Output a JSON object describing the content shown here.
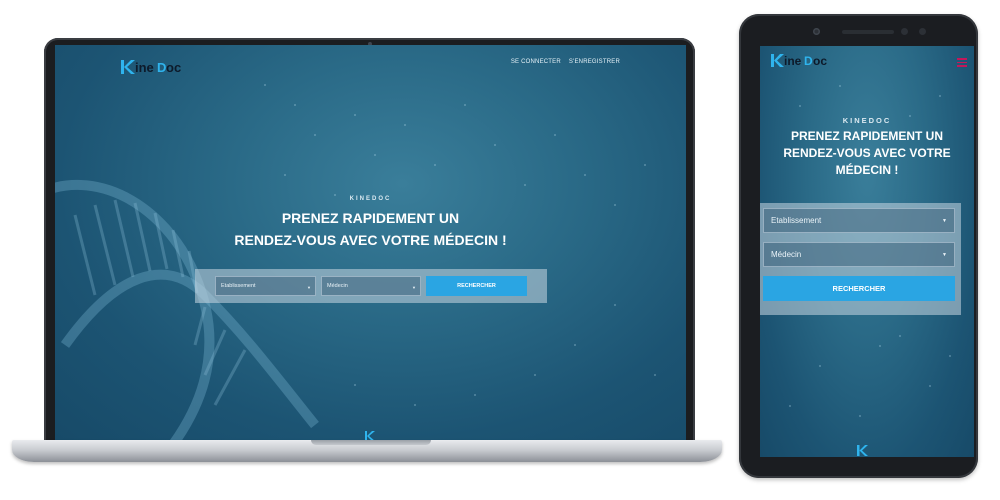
{
  "brand": {
    "logo_text": "KineDoc"
  },
  "laptop": {
    "nav": {
      "login": "SE CONNECTER",
      "register": "S'ENREGISTRER"
    },
    "hero": {
      "eyebrow": "KINEDOC",
      "title_line1": "PRENEZ RAPIDEMENT UN",
      "title_line2": "RENDEZ-VOUS AVEC VOTRE MÉDECIN !"
    },
    "search": {
      "establishment": "Etablissement",
      "doctor": "Médecin",
      "button": "RECHERCHER"
    }
  },
  "phone": {
    "hero": {
      "eyebrow": "KINEDOC",
      "title_line1": "PRENEZ RAPIDEMENT UN",
      "title_line2": "RENDEZ-VOUS AVEC VOTRE",
      "title_line3": "MÉDECIN !"
    },
    "search": {
      "establishment": "Etablissement",
      "doctor": "Médecin",
      "button": "RECHERCHER"
    }
  },
  "colors": {
    "accent": "#2aa5e3",
    "logo_primary": "#2fb4ee",
    "logo_dark": "#0d1a2a",
    "menu_icon": "#c2185b",
    "page_bg": "#1c5473"
  },
  "icons": {
    "caret": "caret-down-icon",
    "menu": "hamburger-menu-icon",
    "brand_mark": "kinedoc-mark-icon"
  }
}
